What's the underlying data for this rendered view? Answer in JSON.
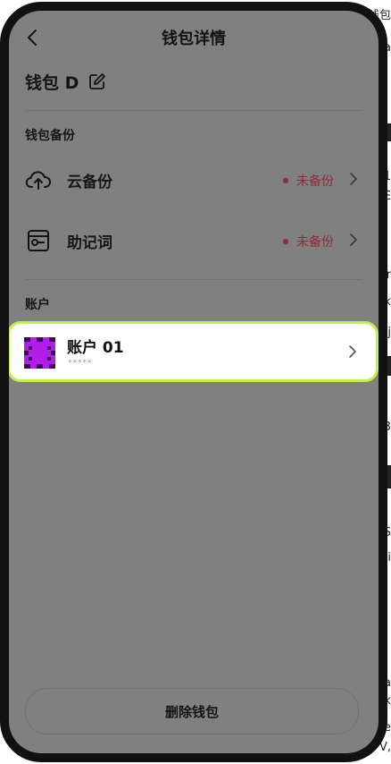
{
  "header": {
    "title": "钱包详情"
  },
  "wallet": {
    "name": "钱包 D"
  },
  "backup_section": {
    "title": "钱包备份",
    "items": [
      {
        "label": "云备份",
        "status": "未备份",
        "icon": "cloud-upload-icon"
      },
      {
        "label": "助记词",
        "status": "未备份",
        "icon": "mnemonic-key-icon"
      }
    ]
  },
  "accounts_section": {
    "title": "账户",
    "accounts": [
      {
        "name": "账户 01",
        "masked": "*****"
      }
    ]
  },
  "footer": {
    "delete_label": "删除钱包"
  },
  "background_fragments": [
    "钱包",
    "a",
    "1",
    "E",
    "r",
    "k",
    "j",
    "3",
    "S",
    "i",
    "a",
    "k",
    "e",
    "V,",
    "I",
    "Y",
    "Q"
  ],
  "colors": {
    "overlay": "#808080",
    "status_red": "#8a2b3f",
    "highlight_green": "#c4f04a",
    "avatar_purple": "#b01ee8"
  }
}
